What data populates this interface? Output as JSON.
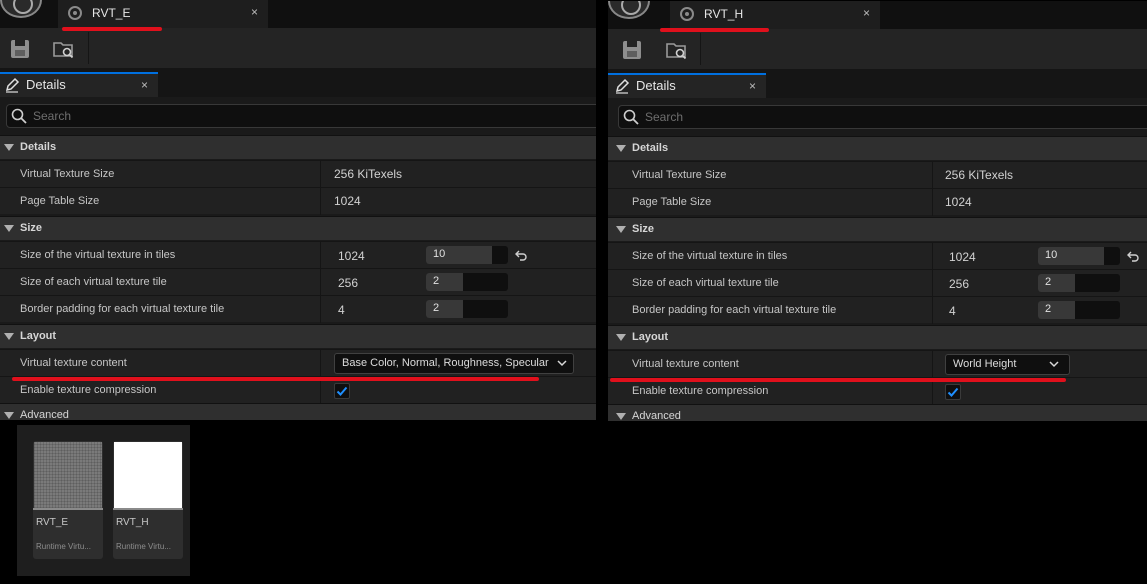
{
  "colors": {
    "accent": "#0070e0",
    "annotation": "#e0101c",
    "panel_bg": "#1a1a1a",
    "section_bg": "#2f2f2f",
    "check": "#1f8fff"
  },
  "icons": {
    "save": "save-icon",
    "browse": "browse-asset-icon",
    "details": "details-pencil-icon",
    "search": "search-icon",
    "close": "close-icon",
    "reset": "reset-to-default-icon",
    "chevron": "chevron-down-icon",
    "check": "checkmark-icon"
  },
  "left": {
    "tab": {
      "title": "RVT_E",
      "close": "×"
    },
    "details_tab": {
      "label": "Details",
      "close": "×"
    },
    "search": {
      "placeholder": "Search"
    },
    "sections": {
      "details": "Details",
      "size": "Size",
      "layout": "Layout",
      "advanced": "Advanced"
    },
    "props": {
      "vt_size": {
        "name": "Virtual Texture Size",
        "value": "256 KiTexels"
      },
      "page_table": {
        "name": "Page Table Size",
        "value": "1024"
      },
      "tiles": {
        "name": "Size of the virtual texture in tiles",
        "value": "1024",
        "slider": "10",
        "fill": 0.8
      },
      "tile_size": {
        "name": "Size of each virtual texture tile",
        "value": "256",
        "slider": "2",
        "fill": 0.45
      },
      "border": {
        "name": "Border padding for each virtual texture tile",
        "value": "4",
        "slider": "2",
        "fill": 0.45
      },
      "content": {
        "name": "Virtual texture content",
        "value": "Base Color, Normal, Roughness, Specular"
      },
      "compression": {
        "name": "Enable texture compression",
        "checked": true
      }
    }
  },
  "right": {
    "tab": {
      "title": "RVT_H",
      "close": "×"
    },
    "details_tab": {
      "label": "Details",
      "close": "×"
    },
    "search": {
      "placeholder": "Search"
    },
    "sections": {
      "details": "Details",
      "size": "Size",
      "layout": "Layout",
      "advanced": "Advanced"
    },
    "props": {
      "vt_size": {
        "name": "Virtual Texture Size",
        "value": "256 KiTexels"
      },
      "page_table": {
        "name": "Page Table Size",
        "value": "1024"
      },
      "tiles": {
        "name": "Size of the virtual texture in tiles",
        "value": "1024",
        "slider": "10",
        "fill": 0.8
      },
      "tile_size": {
        "name": "Size of each virtual texture tile",
        "value": "256",
        "slider": "2",
        "fill": 0.45
      },
      "border": {
        "name": "Border padding for each virtual texture tile",
        "value": "4",
        "slider": "2",
        "fill": 0.45
      },
      "content": {
        "name": "Virtual texture content",
        "value": "World Height"
      },
      "compression": {
        "name": "Enable texture compression",
        "checked": true
      }
    }
  },
  "assets": [
    {
      "name": "RVT_E",
      "type": "Runtime Virtu..."
    },
    {
      "name": "RVT_H",
      "type": "Runtime Virtu..."
    }
  ]
}
